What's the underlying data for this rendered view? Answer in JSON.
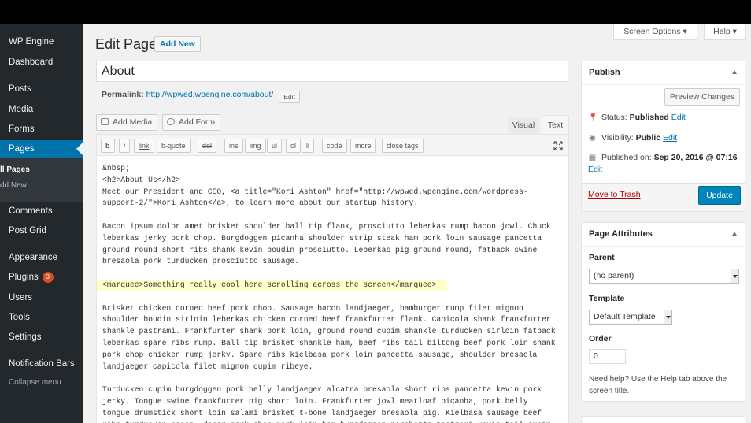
{
  "sidebar": {
    "items": [
      {
        "key": "wp-engine",
        "label": "WP Engine",
        "icon": "wp-engine-icon"
      },
      {
        "key": "dashboard",
        "label": "Dashboard",
        "icon": "dashboard-icon"
      },
      {
        "key": "posts",
        "label": "Posts",
        "icon": "pin-icon"
      },
      {
        "key": "media",
        "label": "Media",
        "icon": "media-icon"
      },
      {
        "key": "forms",
        "label": "Forms",
        "icon": "forms-icon"
      },
      {
        "key": "pages",
        "label": "Pages",
        "icon": "page-icon"
      },
      {
        "key": "comments",
        "label": "Comments",
        "icon": "comment-icon"
      },
      {
        "key": "post-grid",
        "label": "Post Grid",
        "icon": "grid-icon"
      },
      {
        "key": "appearance",
        "label": "Appearance",
        "icon": "brush-icon"
      },
      {
        "key": "plugins",
        "label": "Plugins",
        "icon": "plugin-icon",
        "badge": "3"
      },
      {
        "key": "users",
        "label": "Users",
        "icon": "user-icon"
      },
      {
        "key": "tools",
        "label": "Tools",
        "icon": "wrench-icon"
      },
      {
        "key": "settings",
        "label": "Settings",
        "icon": "settings-icon"
      },
      {
        "key": "notification-bars",
        "label": "Notification Bars",
        "icon": "bell-icon"
      }
    ],
    "submenu": [
      "ll Pages",
      "dd New"
    ],
    "collapse": "Collapse menu"
  },
  "header": {
    "title": "Edit Page",
    "add_new": "Add New",
    "screen_options": "Screen Options",
    "help": "Help"
  },
  "post": {
    "title": "About",
    "permalink_label": "Permalink:",
    "permalink_url": "http://wpwed.wpengine.com/about/",
    "permalink_edit": "Edit"
  },
  "media_buttons": {
    "add_media": "Add Media",
    "add_form": "Add Form"
  },
  "editor_tabs": {
    "visual": "Visual",
    "text": "Text"
  },
  "quicktags": [
    "b",
    "i",
    "link",
    "b-quote",
    "del",
    "ins",
    "img",
    "ul",
    "ol",
    "li",
    "code",
    "more",
    "close tags"
  ],
  "editor_lines": [
    "&nbsp;",
    "<h2>About Us</h2>",
    "Meet our President and CEO, <a title=\"Kori Ashton\" href=\"http://wpwed.wpengine.com/wordpress-",
    "support-2/\">Kori Ashton</a>, to learn more about our startup history.",
    "",
    "Bacon ipsum dolor amet brisket shoulder ball tip flank, prosciutto leberkas rump bacon jowl. Chuck",
    "leberkas jerky pork chop. Burgdoggen picanha shoulder strip steak ham pork loin sausage pancetta",
    "ground round short ribs shank kevin boudin prosciutto. Leberkas pig ground round, fatback swine",
    "bresaola pork turducken prosciutto sausage.",
    "",
    "<marquee>Something really cool here scrolling across the screen</marquee>",
    "",
    "Brisket chicken corned beef pork chop. Sausage bacon landjaeger, hamburger rump filet mignon",
    "shoulder boudin sirloin leberkas chicken corned beef frankfurter flank. Capicola shank frankfurter",
    "shankle pastrami. Frankfurter shank pork loin, ground round cupim shankle turducken sirloin fatback",
    "leberkas spare ribs rump. Ball tip brisket shankle ham, beef ribs tail biltong beef pork loin shank",
    "pork chop chicken rump jerky. Spare ribs kielbasa pork loin pancetta sausage, shoulder bresaola",
    "landjaeger capicola filet mignon cupim ribeye.",
    "",
    "Turducken cupim burgdoggen pork belly landjaeger alcatra bresaola short ribs pancetta kevin pork",
    "jerky. Tongue swine frankfurter pig short loin. Frankfurter jowl meatloaf picanha, pork belly",
    "tongue drumstick short loin salami brisket t-bone landjaeger bresaola pig. Kielbasa sausage beef",
    "ribs turducken bacon, doner pork chop pork loin ham burgdoggen porchetta pastrami kevin tail cupim."
  ],
  "publish": {
    "title": "Publish",
    "preview": "Preview Changes",
    "status_label": "Status:",
    "status_value": "Published",
    "visibility_label": "Visibility:",
    "visibility_value": "Public",
    "published_label": "Published on:",
    "published_value": "Sep 20, 2016 @ 07:16",
    "edit": "Edit",
    "trash": "Move to Trash",
    "update": "Update"
  },
  "page_attributes": {
    "title": "Page Attributes",
    "parent_label": "Parent",
    "parent_value": "(no parent)",
    "template_label": "Template",
    "template_value": "Default Template",
    "order_label": "Order",
    "order_value": "0",
    "help": "Need help? Use the Help tab above the screen title."
  }
}
